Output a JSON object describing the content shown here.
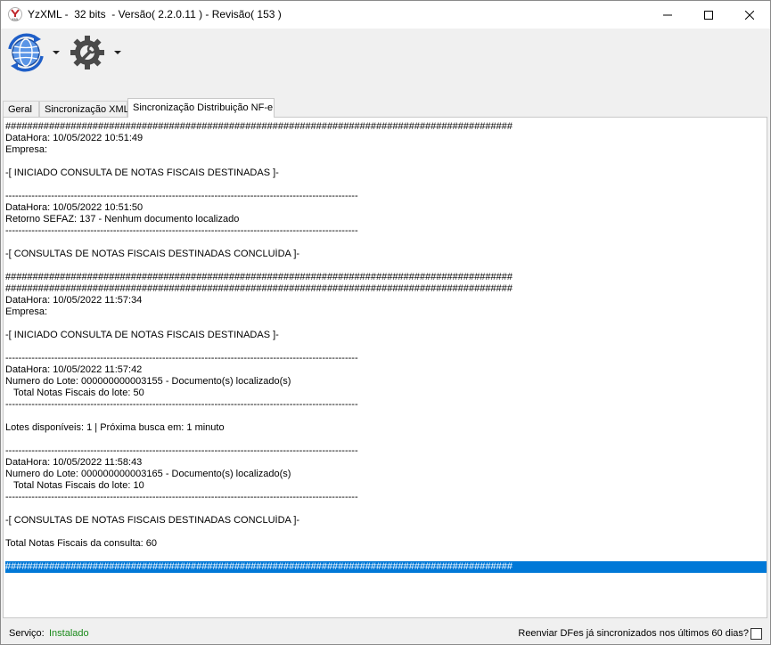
{
  "window": {
    "title": "YzXML -  32 bits  - Versão( 2.2.0.11 ) - Revisão( 153 )",
    "controls": [
      "minimize",
      "maximize",
      "close"
    ]
  },
  "toolbar": {
    "buttons": [
      {
        "icon": "globe-sync-icon",
        "has_dropdown": true
      },
      {
        "icon": "gear-wrench-icon",
        "has_dropdown": true
      }
    ]
  },
  "tabs": [
    {
      "label": "Geral",
      "active": false
    },
    {
      "label": "Sincronização XML",
      "active": false
    },
    {
      "label": "Sincronização Distribuição NF-e",
      "active": true
    }
  ],
  "log": {
    "lines": [
      "#############################################################################################",
      "DataHora: 10/05/2022 10:51:49",
      "Empresa:",
      "",
      "-[ INICIADO CONSULTA DE NOTAS FISCAIS DESTINADAS ]-",
      "",
      "------------------------------------------------------------------------------------------------------------",
      "DataHora: 10/05/2022 10:51:50",
      "Retorno SEFAZ: 137 - Nenhum documento localizado",
      "------------------------------------------------------------------------------------------------------------",
      "",
      "-[ CONSULTAS DE NOTAS FISCAIS DESTINADAS CONCLUÍDA ]-",
      "",
      "#############################################################################################",
      "#############################################################################################",
      "DataHora: 10/05/2022 11:57:34",
      "Empresa:",
      "",
      "-[ INICIADO CONSULTA DE NOTAS FISCAIS DESTINADAS ]-",
      "",
      "------------------------------------------------------------------------------------------------------------",
      "DataHora: 10/05/2022 11:57:42",
      "Numero do Lote: 000000000003155 - Documento(s) localizado(s)",
      "   Total Notas Fiscais do lote: 50",
      "------------------------------------------------------------------------------------------------------------",
      "",
      "Lotes disponíveis: 1 | Próxima busca em: 1 minuto",
      "",
      "------------------------------------------------------------------------------------------------------------",
      "DataHora: 10/05/2022 11:58:43",
      "Numero do Lote: 000000000003165 - Documento(s) localizado(s)",
      "   Total Notas Fiscais do lote: 10",
      "------------------------------------------------------------------------------------------------------------",
      "",
      "-[ CONSULTAS DE NOTAS FISCAIS DESTINADAS CONCLUÍDA ]-",
      "",
      "Total Notas Fiscais da consulta: 60",
      "",
      "#############################################################################################"
    ],
    "selected_line_index": 38
  },
  "status": {
    "service_label": "Serviço:",
    "service_value": "Instalado",
    "service_color": "#1a8a1a",
    "resend_label": "Reenviar DFes já sincronizados nos últimos 60 dias?",
    "resend_checked": false
  },
  "colors": {
    "selection": "#0078d7",
    "accent_blue": "#2f6fd0"
  }
}
